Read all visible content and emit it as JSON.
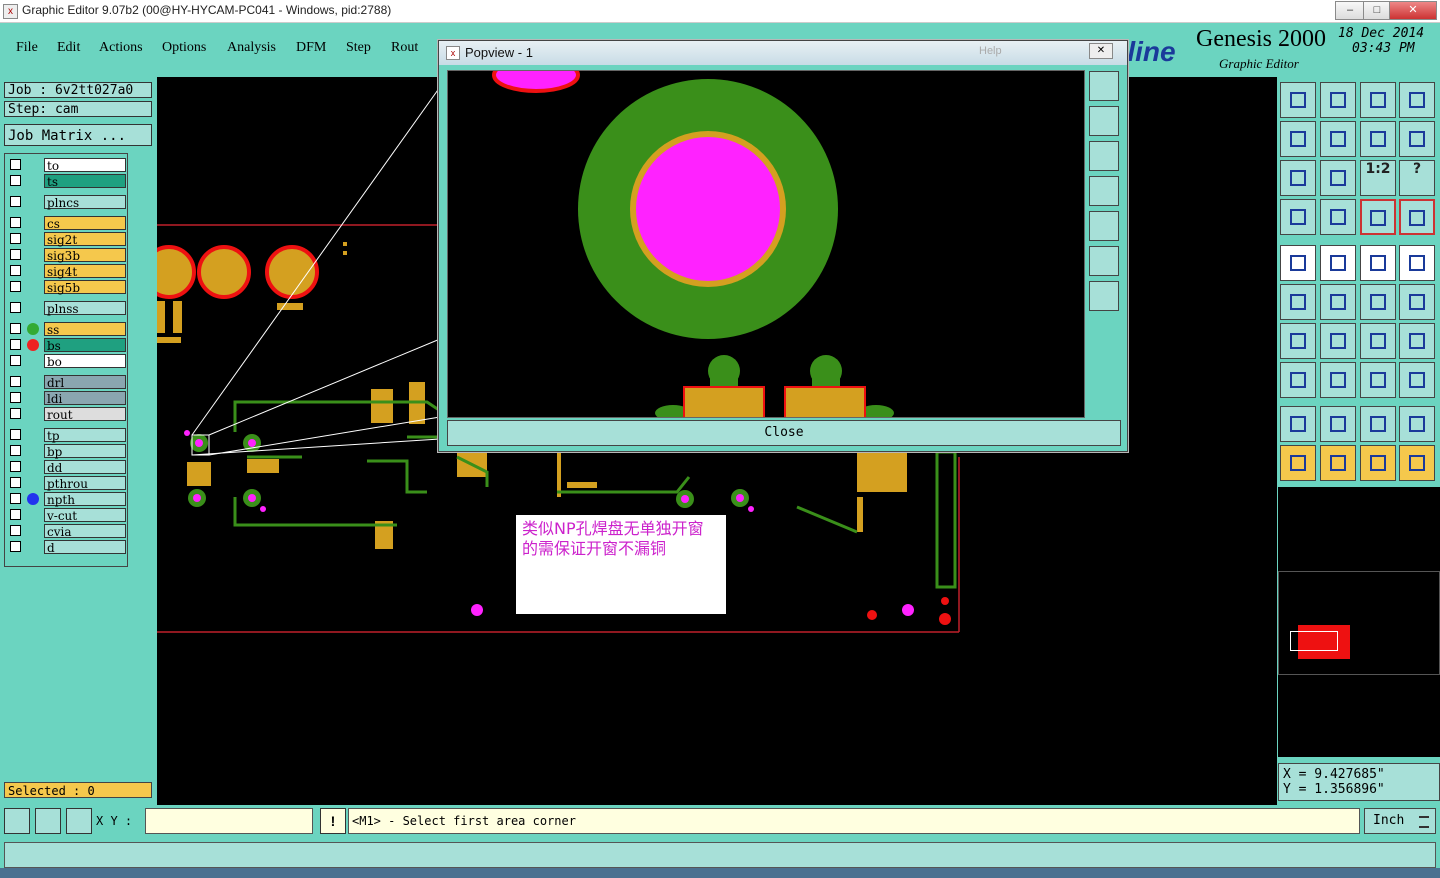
{
  "window": {
    "title": "Graphic Editor 9.07b2 (00@HY-HYCAM-PC041 - Windows, pid:2788)",
    "icon": "x-app-icon"
  },
  "menu": {
    "items": [
      "File",
      "Edit",
      "Actions",
      "Options",
      "Analysis",
      "DFM",
      "Step",
      "Rout"
    ]
  },
  "brand": {
    "logo_text": "tline",
    "product": "Genesis 2000",
    "subtitle": "Graphic Editor",
    "date": "18 Dec 2014",
    "time": "03:43 PM"
  },
  "job": {
    "job_label": "Job : 6v2tt027a0",
    "step_label": "Step: cam",
    "matrix_button": "Job Matrix ..."
  },
  "layers": [
    {
      "name": "to",
      "color": "#ffffff"
    },
    {
      "name": "ts",
      "color": "#1fa080"
    },
    {
      "name": "plncs",
      "color": "#a7e0d8"
    },
    {
      "name": "cs",
      "color": "#f5c84c"
    },
    {
      "name": "sig2t",
      "color": "#f5c84c"
    },
    {
      "name": "sig3b",
      "color": "#f5c84c"
    },
    {
      "name": "sig4t",
      "color": "#f5c84c"
    },
    {
      "name": "sig5b",
      "color": "#f5c84c"
    },
    {
      "name": "plnss",
      "color": "#a7e0d8"
    },
    {
      "name": "ss",
      "color": "#f5c84c",
      "dot": "#33aa33"
    },
    {
      "name": "bs",
      "color": "#1fa080",
      "dot": "#ee2222"
    },
    {
      "name": "bo",
      "color": "#ffffff"
    },
    {
      "name": "drl",
      "color": "#8aa6b0"
    },
    {
      "name": "ldi",
      "color": "#8aa6b0"
    },
    {
      "name": "rout",
      "color": "#dddddd"
    },
    {
      "name": "tp",
      "color": "#a7e0d8"
    },
    {
      "name": "bp",
      "color": "#a7e0d8"
    },
    {
      "name": "dd",
      "color": "#a7e0d8"
    },
    {
      "name": "pthrou",
      "color": "#a7e0d8"
    },
    {
      "name": "npth",
      "color": "#a7e0d8",
      "dot": "#2233ee"
    },
    {
      "name": "v-cut",
      "color": "#a7e0d8"
    },
    {
      "name": "cvia",
      "color": "#a7e0d8"
    },
    {
      "name": "d",
      "color": "#a7e0d8"
    }
  ],
  "selected": "Selected : 0",
  "popview": {
    "title": "Popview - 1",
    "close_label": "Close",
    "help_label": "Help"
  },
  "annotation": {
    "text": "类似NP孔焊盘无单独开窗的需保证开窗不漏铜"
  },
  "coords": {
    "x": "X = 9.427685\"",
    "y": "Y = 1.356896\""
  },
  "bottom": {
    "xy_label": "X Y :",
    "xy_value": "",
    "warn_icon": "!",
    "prompt": "<M1> - Select first area corner",
    "unit": "Inch"
  },
  "toolbar_zoom_label": "1:2",
  "toolbar_help_label": "?"
}
